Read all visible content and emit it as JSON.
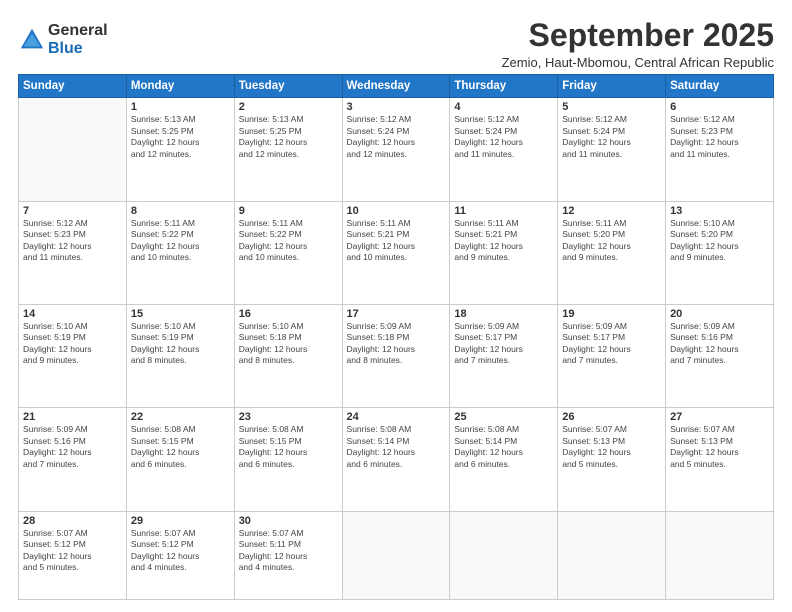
{
  "logo": {
    "general": "General",
    "blue": "Blue"
  },
  "header": {
    "title": "September 2025",
    "subtitle": "Zemio, Haut-Mbomou, Central African Republic"
  },
  "days_of_week": [
    "Sunday",
    "Monday",
    "Tuesday",
    "Wednesday",
    "Thursday",
    "Friday",
    "Saturday"
  ],
  "weeks": [
    [
      {
        "day": "",
        "info": ""
      },
      {
        "day": "1",
        "info": "Sunrise: 5:13 AM\nSunset: 5:25 PM\nDaylight: 12 hours\nand 12 minutes."
      },
      {
        "day": "2",
        "info": "Sunrise: 5:13 AM\nSunset: 5:25 PM\nDaylight: 12 hours\nand 12 minutes."
      },
      {
        "day": "3",
        "info": "Sunrise: 5:12 AM\nSunset: 5:24 PM\nDaylight: 12 hours\nand 12 minutes."
      },
      {
        "day": "4",
        "info": "Sunrise: 5:12 AM\nSunset: 5:24 PM\nDaylight: 12 hours\nand 11 minutes."
      },
      {
        "day": "5",
        "info": "Sunrise: 5:12 AM\nSunset: 5:24 PM\nDaylight: 12 hours\nand 11 minutes."
      },
      {
        "day": "6",
        "info": "Sunrise: 5:12 AM\nSunset: 5:23 PM\nDaylight: 12 hours\nand 11 minutes."
      }
    ],
    [
      {
        "day": "7",
        "info": "Sunrise: 5:12 AM\nSunset: 5:23 PM\nDaylight: 12 hours\nand 11 minutes."
      },
      {
        "day": "8",
        "info": "Sunrise: 5:11 AM\nSunset: 5:22 PM\nDaylight: 12 hours\nand 10 minutes."
      },
      {
        "day": "9",
        "info": "Sunrise: 5:11 AM\nSunset: 5:22 PM\nDaylight: 12 hours\nand 10 minutes."
      },
      {
        "day": "10",
        "info": "Sunrise: 5:11 AM\nSunset: 5:21 PM\nDaylight: 12 hours\nand 10 minutes."
      },
      {
        "day": "11",
        "info": "Sunrise: 5:11 AM\nSunset: 5:21 PM\nDaylight: 12 hours\nand 9 minutes."
      },
      {
        "day": "12",
        "info": "Sunrise: 5:11 AM\nSunset: 5:20 PM\nDaylight: 12 hours\nand 9 minutes."
      },
      {
        "day": "13",
        "info": "Sunrise: 5:10 AM\nSunset: 5:20 PM\nDaylight: 12 hours\nand 9 minutes."
      }
    ],
    [
      {
        "day": "14",
        "info": "Sunrise: 5:10 AM\nSunset: 5:19 PM\nDaylight: 12 hours\nand 9 minutes."
      },
      {
        "day": "15",
        "info": "Sunrise: 5:10 AM\nSunset: 5:19 PM\nDaylight: 12 hours\nand 8 minutes."
      },
      {
        "day": "16",
        "info": "Sunrise: 5:10 AM\nSunset: 5:18 PM\nDaylight: 12 hours\nand 8 minutes."
      },
      {
        "day": "17",
        "info": "Sunrise: 5:09 AM\nSunset: 5:18 PM\nDaylight: 12 hours\nand 8 minutes."
      },
      {
        "day": "18",
        "info": "Sunrise: 5:09 AM\nSunset: 5:17 PM\nDaylight: 12 hours\nand 7 minutes."
      },
      {
        "day": "19",
        "info": "Sunrise: 5:09 AM\nSunset: 5:17 PM\nDaylight: 12 hours\nand 7 minutes."
      },
      {
        "day": "20",
        "info": "Sunrise: 5:09 AM\nSunset: 5:16 PM\nDaylight: 12 hours\nand 7 minutes."
      }
    ],
    [
      {
        "day": "21",
        "info": "Sunrise: 5:09 AM\nSunset: 5:16 PM\nDaylight: 12 hours\nand 7 minutes."
      },
      {
        "day": "22",
        "info": "Sunrise: 5:08 AM\nSunset: 5:15 PM\nDaylight: 12 hours\nand 6 minutes."
      },
      {
        "day": "23",
        "info": "Sunrise: 5:08 AM\nSunset: 5:15 PM\nDaylight: 12 hours\nand 6 minutes."
      },
      {
        "day": "24",
        "info": "Sunrise: 5:08 AM\nSunset: 5:14 PM\nDaylight: 12 hours\nand 6 minutes."
      },
      {
        "day": "25",
        "info": "Sunrise: 5:08 AM\nSunset: 5:14 PM\nDaylight: 12 hours\nand 6 minutes."
      },
      {
        "day": "26",
        "info": "Sunrise: 5:07 AM\nSunset: 5:13 PM\nDaylight: 12 hours\nand 5 minutes."
      },
      {
        "day": "27",
        "info": "Sunrise: 5:07 AM\nSunset: 5:13 PM\nDaylight: 12 hours\nand 5 minutes."
      }
    ],
    [
      {
        "day": "28",
        "info": "Sunrise: 5:07 AM\nSunset: 5:12 PM\nDaylight: 12 hours\nand 5 minutes."
      },
      {
        "day": "29",
        "info": "Sunrise: 5:07 AM\nSunset: 5:12 PM\nDaylight: 12 hours\nand 4 minutes."
      },
      {
        "day": "30",
        "info": "Sunrise: 5:07 AM\nSunset: 5:11 PM\nDaylight: 12 hours\nand 4 minutes."
      },
      {
        "day": "",
        "info": ""
      },
      {
        "day": "",
        "info": ""
      },
      {
        "day": "",
        "info": ""
      },
      {
        "day": "",
        "info": ""
      }
    ]
  ]
}
